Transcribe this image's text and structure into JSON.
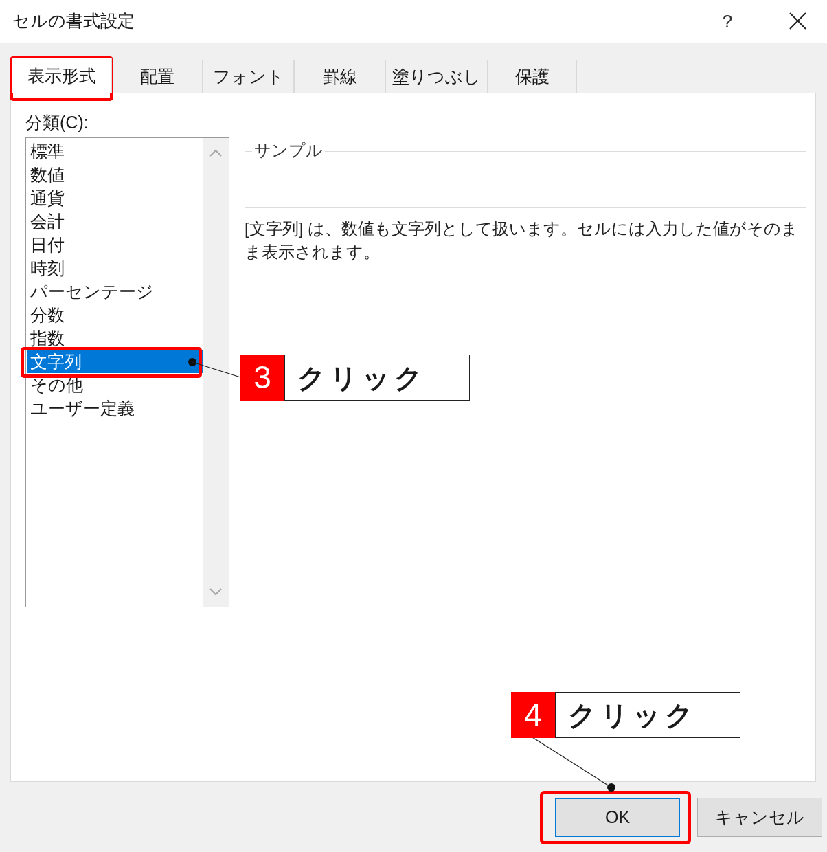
{
  "window": {
    "title": "セルの書式設定",
    "help": "?"
  },
  "tabs": [
    {
      "label": "表示形式",
      "selected": true
    },
    {
      "label": "配置",
      "selected": false
    },
    {
      "label": "フォント",
      "selected": false
    },
    {
      "label": "罫線",
      "selected": false
    },
    {
      "label": "塗りつぶし",
      "selected": false
    },
    {
      "label": "保護",
      "selected": false
    }
  ],
  "category_label": "分類(C):",
  "categories": [
    {
      "label": "標準",
      "selected": false
    },
    {
      "label": "数値",
      "selected": false
    },
    {
      "label": "通貨",
      "selected": false
    },
    {
      "label": "会計",
      "selected": false
    },
    {
      "label": "日付",
      "selected": false
    },
    {
      "label": "時刻",
      "selected": false
    },
    {
      "label": "パーセンテージ",
      "selected": false
    },
    {
      "label": "分数",
      "selected": false
    },
    {
      "label": "指数",
      "selected": false
    },
    {
      "label": "文字列",
      "selected": true
    },
    {
      "label": "その他",
      "selected": false
    },
    {
      "label": "ユーザー定義",
      "selected": false
    }
  ],
  "sample": {
    "legend": "サンプル"
  },
  "description": "[文字列] は、数値も文字列として扱います。セルには入力した値がそのまま表示されます。",
  "buttons": [
    {
      "label": "OK",
      "kind": "default"
    },
    {
      "label": "キャンセル",
      "kind": "normal"
    }
  ],
  "annotations": [
    {
      "number": "3",
      "text": "クリック"
    },
    {
      "number": "4",
      "text": "クリック"
    }
  ]
}
